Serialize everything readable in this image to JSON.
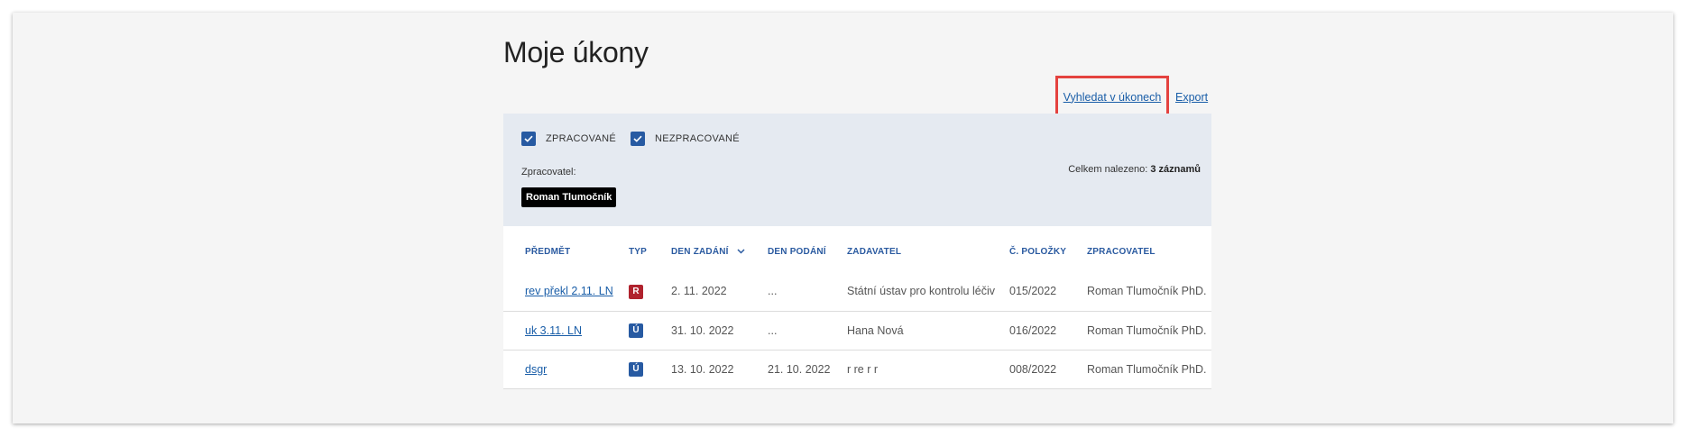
{
  "page": {
    "title": "Moje úkony"
  },
  "links": {
    "search": "Vyhledat v úkonech",
    "export": "Export"
  },
  "filters": {
    "checkboxes": [
      {
        "label": "ZPRACOVANÉ",
        "checked": true
      },
      {
        "label": "NEZPRACOVANÉ",
        "checked": true
      }
    ],
    "processor_label": "Zpracovatel:",
    "processor_chip": "Roman Tlumočník",
    "found_prefix": "Celkem nalezeno:",
    "found_count": "3 záznamů"
  },
  "table": {
    "headers": [
      "PŘEDMĚT",
      "TYP",
      "DEN ZADÁNÍ",
      "DEN PODÁNÍ",
      "ZADAVATEL",
      "Č. POLOŽKY",
      "ZPRACOVATEL"
    ],
    "rows": [
      {
        "subject": "rev překl 2.11. LN",
        "type": "R",
        "type_color": "#b0222d",
        "assigned": "2. 11. 2022",
        "submitted": "...",
        "client": "Státní ústav pro kontrolu léčiv",
        "item_no": "015/2022",
        "processor": "Roman Tlumočník PhD."
      },
      {
        "subject": "uk 3.11. LN",
        "type": "Ú",
        "type_color": "#275aa2",
        "assigned": "31. 10. 2022",
        "submitted": "...",
        "client": "Hana Nová",
        "item_no": "016/2022",
        "processor": "Roman Tlumočník PhD."
      },
      {
        "subject": "dsgr",
        "type": "Ú",
        "type_color": "#275aa2",
        "assigned": "13. 10. 2022",
        "submitted": "21. 10. 2022",
        "client": "r re r r",
        "item_no": "008/2022",
        "processor": "Roman Tlumočník PhD."
      }
    ]
  },
  "colors": {
    "accent": "#275aa2",
    "link": "#1a5ea8",
    "highlight": "#e4423f",
    "panel": "#e5eaf1"
  },
  "icons": {
    "checkbox": "check-icon",
    "sort": "chevron-down-icon"
  }
}
